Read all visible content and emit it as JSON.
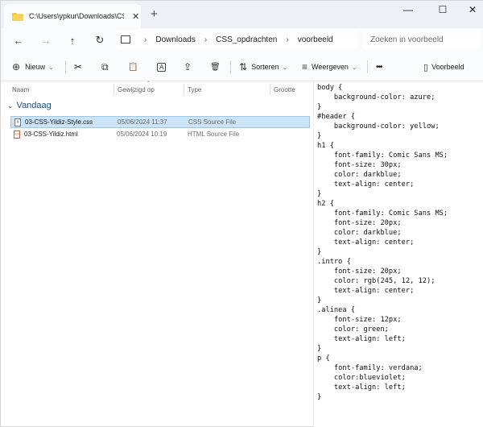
{
  "tab": {
    "title": "C:\\Users\\ypkur\\Downloads\\CS",
    "close": "✕",
    "new_tab": "+"
  },
  "window_controls": {
    "minimize": "—",
    "maximize": "☐",
    "close": "✕"
  },
  "nav": {
    "back": "←",
    "forward": "→",
    "up": "↑",
    "refresh": "↻"
  },
  "address": {
    "crumbs": [
      "Downloads",
      "CSS_opdrachten",
      "voorbeeld"
    ],
    "separator": "›"
  },
  "search": {
    "placeholder": "Zoeken in voorbeeld"
  },
  "toolbar": {
    "new_label": "Nieuw",
    "new_icon": "⊕",
    "cut_icon": "✂",
    "copy_icon": "⧉",
    "paste_icon": "📋",
    "rename_icon": "A",
    "share_icon": "⇪",
    "delete_icon": "🗑",
    "sort_label": "Sorteren",
    "sort_icon": "⇅",
    "view_label": "Weergeven",
    "view_icon": "≡",
    "more_label": "•••",
    "preview_label": "Voorbeeld",
    "preview_icon": "▯",
    "dropdown_caret": "⌄"
  },
  "columns": {
    "name": "Naam",
    "modified": "Gewijzigd op",
    "type": "Type",
    "size": "Grootte"
  },
  "group": {
    "label": "Vandaag",
    "chevron": "⌄"
  },
  "files": [
    {
      "name": "03-CSS-Yildiz-Style.css",
      "modified": "05/06/2024 11:37",
      "type": "CSS Source File",
      "icon": "css-file-icon",
      "selected": true
    },
    {
      "name": "03-CSS-Yildiz.html",
      "modified": "05/06/2024 10:19",
      "type": "HTML Source File",
      "icon": "html-file-icon",
      "selected": false
    }
  ],
  "preview_code": "body {\n    background-color: azure;\n}\n#header {\n    background-color: yellow;\n}\nh1 {\n    font-family: Comic Sans MS;\n    font-size: 30px;\n    color: darkblue;\n    text-align: center;\n}\nh2 {\n    font-family: Comic Sans MS;\n    font-size: 20px;\n    color: darkblue;\n    text-align: center;\n}\n.intro {\n    font-size: 20px;\n    color: rgb(245, 12, 12);\n    text-align: center;\n}\n.alinea {\n    font-size: 12px;\n    color: green;\n    text-align: left;\n}\np {\n    font-family: verdana;\n    color:blueviolet;\n    text-align: left;\n}"
}
